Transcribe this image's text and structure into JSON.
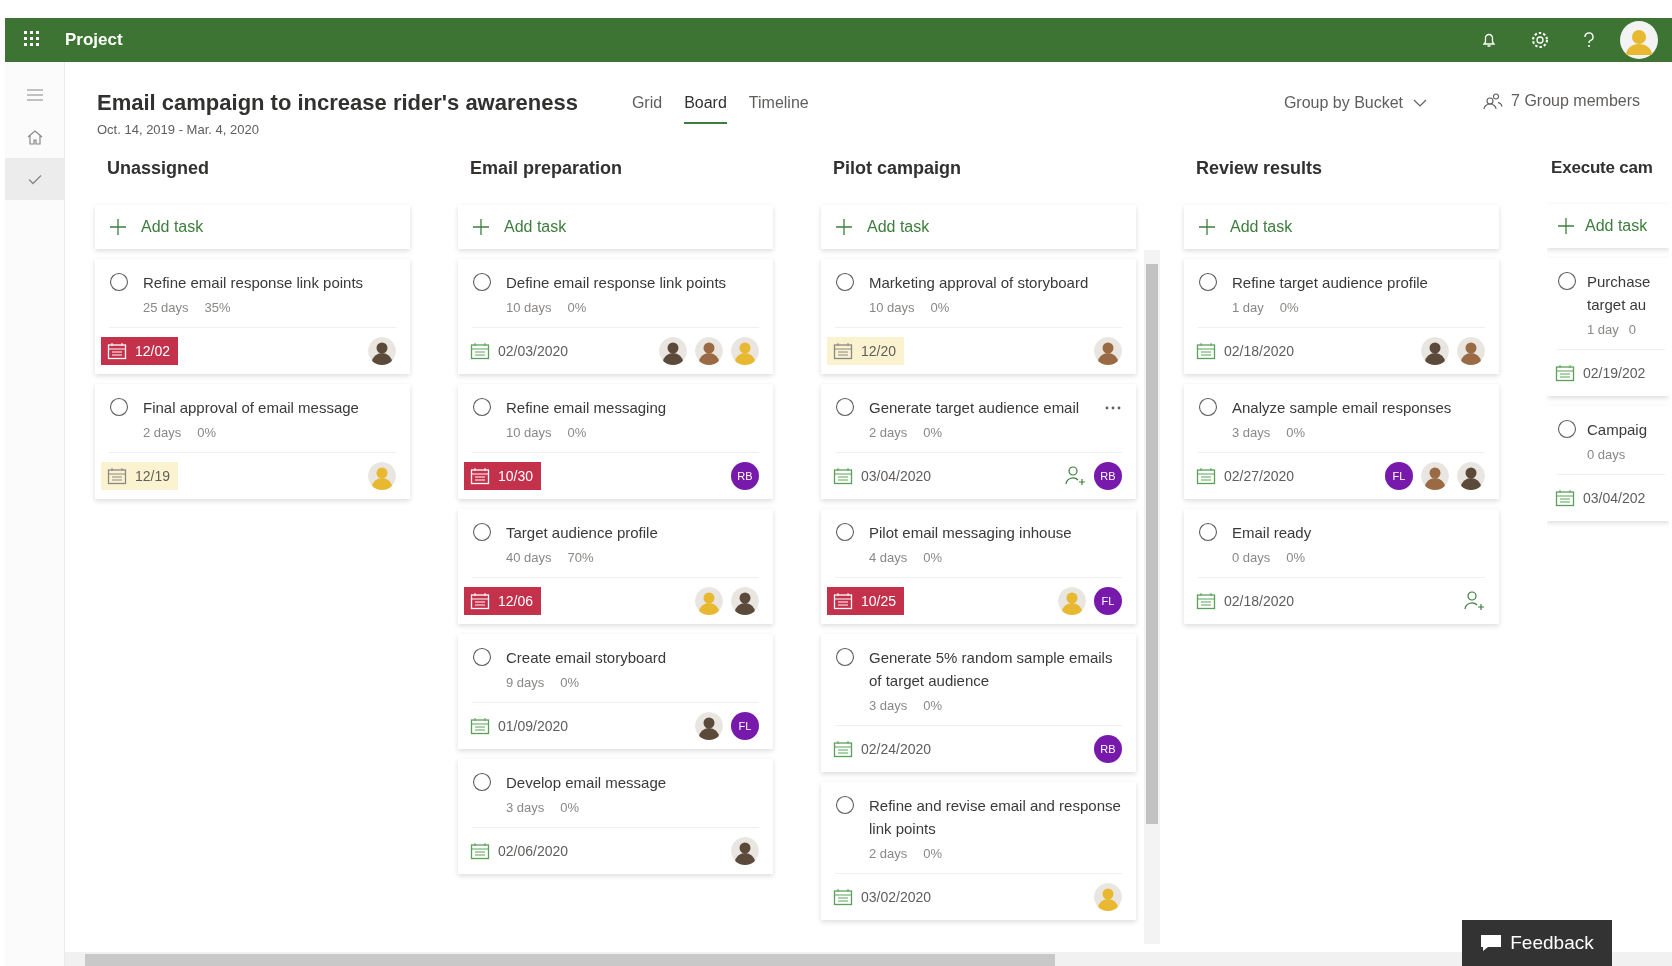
{
  "app_bar": {
    "title": "Project",
    "user_avatar": {
      "color": "#e8b830"
    }
  },
  "rail": [
    {
      "kind": "menu",
      "selected": false
    },
    {
      "kind": "home",
      "selected": false
    },
    {
      "kind": "tasks",
      "selected": true
    }
  ],
  "plan": {
    "title": "Email campaign to increase rider's awareness",
    "dates": "Oct. 14, 2019 - Mar. 4, 2020"
  },
  "views": [
    {
      "label": "Grid",
      "selected": false
    },
    {
      "label": "Board",
      "selected": true
    },
    {
      "label": "Timeline",
      "selected": false
    }
  ],
  "group_by": "Group by Bucket",
  "members": "7 Group members",
  "buckets": [
    {
      "title": "Unassigned",
      "add_task_label": "Add task",
      "tasks": [
        {
          "title": "Refine email response link points",
          "completed": false,
          "duration": "25 days",
          "percent": "35%",
          "due": "12/02",
          "overdue": true,
          "due_soon": false,
          "assignees": [
            {
              "kind": "photo",
              "color": "#5b4a3a"
            }
          ]
        },
        {
          "title": "Final approval of email message",
          "completed": false,
          "duration": "2 days",
          "percent": "0%",
          "due": "12/19",
          "overdue": false,
          "due_soon": true,
          "assignees": [
            {
              "kind": "photo",
              "color": "#e8b830"
            }
          ]
        }
      ]
    },
    {
      "title": "Email preparation",
      "add_task_label": "Add task",
      "tasks": [
        {
          "title": "Define email response link points",
          "completed": false,
          "duration": "10 days",
          "percent": "0%",
          "due": "02/03/2020",
          "overdue": false,
          "due_soon": false,
          "assignees": [
            {
              "kind": "photo",
              "color": "#5b4a3a"
            },
            {
              "kind": "photo",
              "color": "#9a6a44"
            },
            {
              "kind": "photo",
              "color": "#e8b830"
            }
          ]
        },
        {
          "title": "Refine email messaging",
          "completed": false,
          "duration": "10 days",
          "percent": "0%",
          "due": "10/30",
          "overdue": true,
          "due_soon": false,
          "assignees": [
            {
              "kind": "initials",
              "initials": "RB",
              "color": "#7719aa"
            }
          ]
        },
        {
          "title": "Target audience profile",
          "completed": false,
          "duration": "40 days",
          "percent": "70%",
          "due": "12/06",
          "overdue": true,
          "due_soon": false,
          "assignees": [
            {
              "kind": "photo",
              "color": "#e8b830"
            },
            {
              "kind": "photo",
              "color": "#5b4a3a"
            }
          ]
        },
        {
          "title": "Create email storyboard",
          "completed": false,
          "duration": "9 days",
          "percent": "0%",
          "due": "01/09/2020",
          "overdue": false,
          "due_soon": false,
          "assignees": [
            {
              "kind": "photo",
              "color": "#5b4a3a"
            },
            {
              "kind": "initials",
              "initials": "FL",
              "color": "#7719aa"
            }
          ]
        },
        {
          "title": "Develop email message",
          "completed": false,
          "duration": "3 days",
          "percent": "0%",
          "due": "02/06/2020",
          "overdue": false,
          "due_soon": false,
          "assignees": [
            {
              "kind": "photo",
              "color": "#5b4a3a"
            }
          ]
        }
      ]
    },
    {
      "title": "Pilot campaign",
      "add_task_label": "Add task",
      "scrollbar": true,
      "tasks": [
        {
          "title": "Marketing approval of storyboard",
          "completed": false,
          "duration": "10 days",
          "percent": "0%",
          "due": "12/20",
          "overdue": false,
          "due_soon": true,
          "assignees": [
            {
              "kind": "photo",
              "color": "#9a6a44"
            }
          ]
        },
        {
          "title": "Generate target audience email",
          "completed": false,
          "more_button": true,
          "duration": "2 days",
          "percent": "0%",
          "due": "03/04/2020",
          "overdue": false,
          "due_soon": false,
          "assign_button": true,
          "assignees": [
            {
              "kind": "initials",
              "initials": "RB",
              "color": "#7719aa"
            }
          ]
        },
        {
          "title": "Pilot email messaging inhouse",
          "completed": false,
          "duration": "4 days",
          "percent": "0%",
          "due": "10/25",
          "overdue": true,
          "due_soon": false,
          "assignees": [
            {
              "kind": "photo",
              "color": "#e8b830"
            },
            {
              "kind": "initials",
              "initials": "FL",
              "color": "#7719aa"
            }
          ]
        },
        {
          "title": "Generate 5% random sample emails of target audience",
          "completed": false,
          "duration": "3 days",
          "percent": "0%",
          "due": "02/24/2020",
          "overdue": false,
          "due_soon": false,
          "assignees": [
            {
              "kind": "initials",
              "initials": "RB",
              "color": "#7719aa"
            }
          ]
        },
        {
          "title": "Refine and revise email and response link points",
          "completed": false,
          "duration": "2 days",
          "percent": "0%",
          "due": "03/02/2020",
          "overdue": false,
          "due_soon": false,
          "assignees": [
            {
              "kind": "photo",
              "color": "#e8b830"
            }
          ]
        }
      ]
    },
    {
      "title": "Review results",
      "add_task_label": "Add task",
      "tasks": [
        {
          "title": "Refine target audience profile",
          "completed": false,
          "duration": "1 day",
          "percent": "0%",
          "due": "02/18/2020",
          "overdue": false,
          "due_soon": false,
          "assignees": [
            {
              "kind": "photo",
              "color": "#5b4a3a"
            },
            {
              "kind": "photo",
              "color": "#9a6a44"
            }
          ]
        },
        {
          "title": "Analyze sample email responses",
          "completed": false,
          "duration": "3 days",
          "percent": "0%",
          "due": "02/27/2020",
          "overdue": false,
          "due_soon": false,
          "assignees": [
            {
              "kind": "initials",
              "initials": "FL",
              "color": "#7719aa"
            },
            {
              "kind": "photo",
              "color": "#9a6a44"
            },
            {
              "kind": "photo",
              "color": "#5b4a3a"
            }
          ]
        },
        {
          "title": "Email ready",
          "completed": false,
          "duration": "0 days",
          "percent": "0%",
          "due": "02/18/2020",
          "overdue": false,
          "due_soon": false,
          "assign_button": true
        }
      ]
    },
    {
      "title": "Execute cam",
      "add_task_label": "Add task",
      "tasks": [
        {
          "title": "Purchase target au",
          "completed": false,
          "duration": "1 day",
          "percent": "0",
          "due": "02/19/202",
          "overdue": false,
          "due_soon": false
        },
        {
          "title": "Campaig",
          "completed": false,
          "duration": "0 days",
          "due": "03/04/202",
          "overdue": false,
          "due_soon": false
        }
      ]
    }
  ],
  "feedback": "Feedback"
}
